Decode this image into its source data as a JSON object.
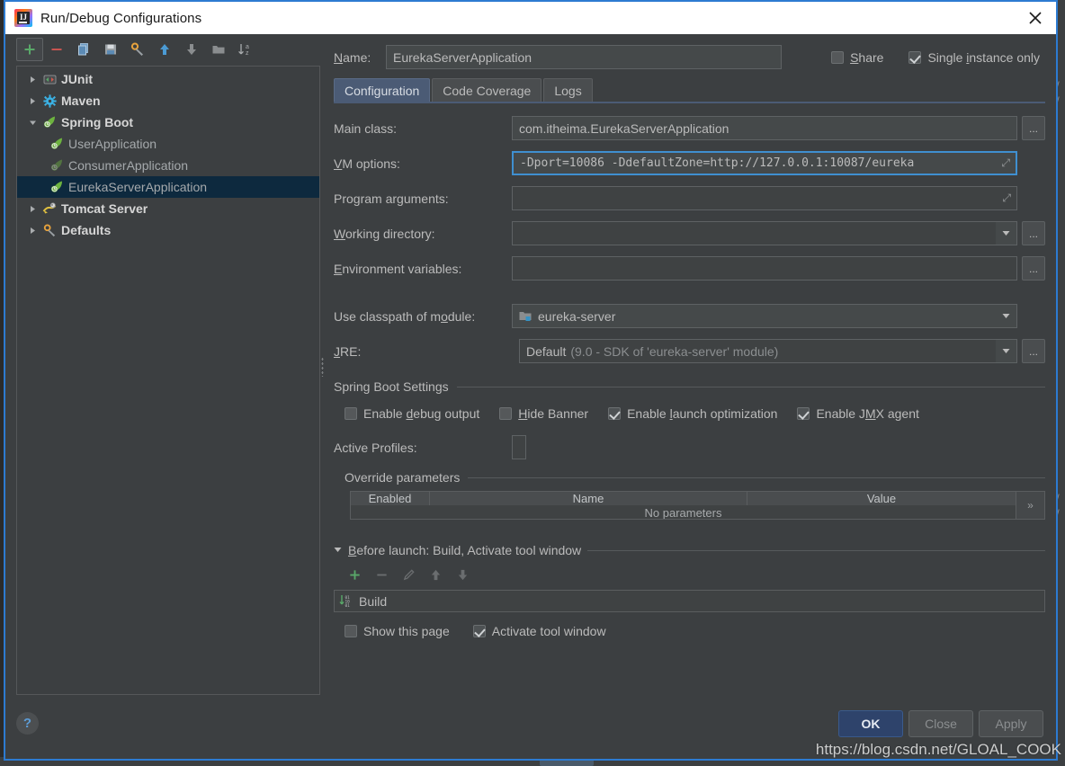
{
  "window": {
    "title": "Run/Debug Configurations",
    "app_icon": "intellij-idea-icon",
    "close_icon": "close-icon"
  },
  "left_toolbar": {
    "buttons": [
      {
        "name": "add-configuration-button",
        "icon": "plus-icon",
        "active": true
      },
      {
        "name": "remove-configuration-button",
        "icon": "minus-icon",
        "active": false
      },
      {
        "name": "copy-configuration-button",
        "icon": "copy-icon",
        "active": false
      },
      {
        "name": "save-configuration-button",
        "icon": "save-icon",
        "active": false
      },
      {
        "name": "edit-defaults-button",
        "icon": "wrench-icon",
        "active": false
      },
      {
        "name": "move-up-button",
        "icon": "arrow-up-icon",
        "active": false
      },
      {
        "name": "move-down-button",
        "icon": "arrow-down-icon",
        "active": false
      },
      {
        "name": "create-folder-button",
        "icon": "folder-icon",
        "active": false
      },
      {
        "name": "sort-configurations-button",
        "icon": "sort-az-icon",
        "active": false
      }
    ]
  },
  "tree": {
    "items": [
      {
        "label": "JUnit",
        "level": 0,
        "expanded": false,
        "icon": "junit-icon",
        "selected": false,
        "dim": false
      },
      {
        "label": "Maven",
        "level": 0,
        "expanded": false,
        "icon": "maven-icon",
        "selected": false,
        "dim": false
      },
      {
        "label": "Spring Boot",
        "level": 0,
        "expanded": true,
        "icon": "spring-icon",
        "selected": false,
        "dim": false
      },
      {
        "label": "UserApplication",
        "level": 1,
        "expanded": null,
        "icon": "spring-icon",
        "selected": false,
        "dim": false
      },
      {
        "label": "ConsumerApplication",
        "level": 1,
        "expanded": null,
        "icon": "spring-icon-dim",
        "selected": false,
        "dim": true
      },
      {
        "label": "EurekaServerApplication",
        "level": 1,
        "expanded": null,
        "icon": "spring-icon",
        "selected": true,
        "dim": false
      },
      {
        "label": "Tomcat Server",
        "level": 0,
        "expanded": false,
        "icon": "tomcat-icon",
        "selected": false,
        "dim": false
      },
      {
        "label": "Defaults",
        "level": 0,
        "expanded": false,
        "icon": "wrench-icon",
        "selected": false,
        "dim": false
      }
    ]
  },
  "header": {
    "name_label": "Name:",
    "name_value": "EurekaServerApplication",
    "share_label": "Share",
    "share_checked": false,
    "single_instance_label": "Single instance only",
    "single_instance_checked": true
  },
  "tabs": [
    {
      "label": "Configuration",
      "active": true
    },
    {
      "label": "Code Coverage",
      "active": false
    },
    {
      "label": "Logs",
      "active": false
    }
  ],
  "form": {
    "main_class_label": "Main class:",
    "main_class_value": "com.itheima.EurekaServerApplication",
    "vm_options_label": "VM options:",
    "vm_options_value": "-Dport=10086 -DdefaultZone=http://127.0.0.1:10087/eureka",
    "program_arguments_label": "Program arguments:",
    "program_arguments_value": "",
    "working_directory_label": "Working directory:",
    "working_directory_value": "",
    "environment_variables_label": "Environment variables:",
    "environment_variables_value": "",
    "use_classpath_label": "Use classpath of module:",
    "use_classpath_value": "eureka-server",
    "use_classpath_icon": "module-folder-icon",
    "jre_label": "JRE:",
    "jre_value": "Default",
    "jre_hint": "(9.0 - SDK of 'eureka-server' module)",
    "browse_label": "..."
  },
  "spring_boot_settings": {
    "title": "Spring Boot Settings",
    "checkboxes": [
      {
        "label": "Enable debug output",
        "checked": false
      },
      {
        "label": "Hide Banner",
        "checked": false
      },
      {
        "label": "Enable launch optimization",
        "checked": true
      },
      {
        "label": "Enable JMX agent",
        "checked": true
      }
    ],
    "active_profiles_label": "Active Profiles:",
    "active_profiles_value": "",
    "override_parameters_title": "Override parameters",
    "table": {
      "columns": [
        "Enabled",
        "Name",
        "Value"
      ],
      "rows": [],
      "empty_text": "No parameters",
      "expand_label": "»"
    }
  },
  "before_launch": {
    "title": "Before launch: Build, Activate tool window",
    "toolbar": [
      {
        "name": "add-before-launch-task-button",
        "icon": "plus-icon",
        "enabled": true
      },
      {
        "name": "remove-before-launch-task-button",
        "icon": "minus-icon",
        "enabled": false
      },
      {
        "name": "edit-before-launch-task-button",
        "icon": "pencil-icon",
        "enabled": false
      },
      {
        "name": "move-task-up-button",
        "icon": "arrow-up-icon",
        "enabled": false
      },
      {
        "name": "move-task-down-button",
        "icon": "arrow-down-icon",
        "enabled": false
      }
    ],
    "tasks": [
      {
        "label": "Build",
        "icon": "build-icon"
      }
    ],
    "show_page_label": "Show this page",
    "show_page_checked": false,
    "activate_tool_window_label": "Activate tool window",
    "activate_tool_window_checked": true
  },
  "footer": {
    "help_label": "?",
    "buttons": [
      {
        "label": "OK",
        "primary": true,
        "disabled": false
      },
      {
        "label": "Close",
        "primary": false,
        "disabled": true
      },
      {
        "label": "Apply",
        "primary": false,
        "disabled": true
      }
    ]
  },
  "watermark": "https://blog.csdn.net/GLOAL_COOK",
  "colors": {
    "dialog_bg": "#3c3f41",
    "field_bg": "#45494a",
    "accent_blue": "#2d7bd1",
    "tab_active": "#4b5b75",
    "selection": "#0d293e",
    "text": "#bbbbbb",
    "green": "#5fad52",
    "red": "#c75450"
  }
}
